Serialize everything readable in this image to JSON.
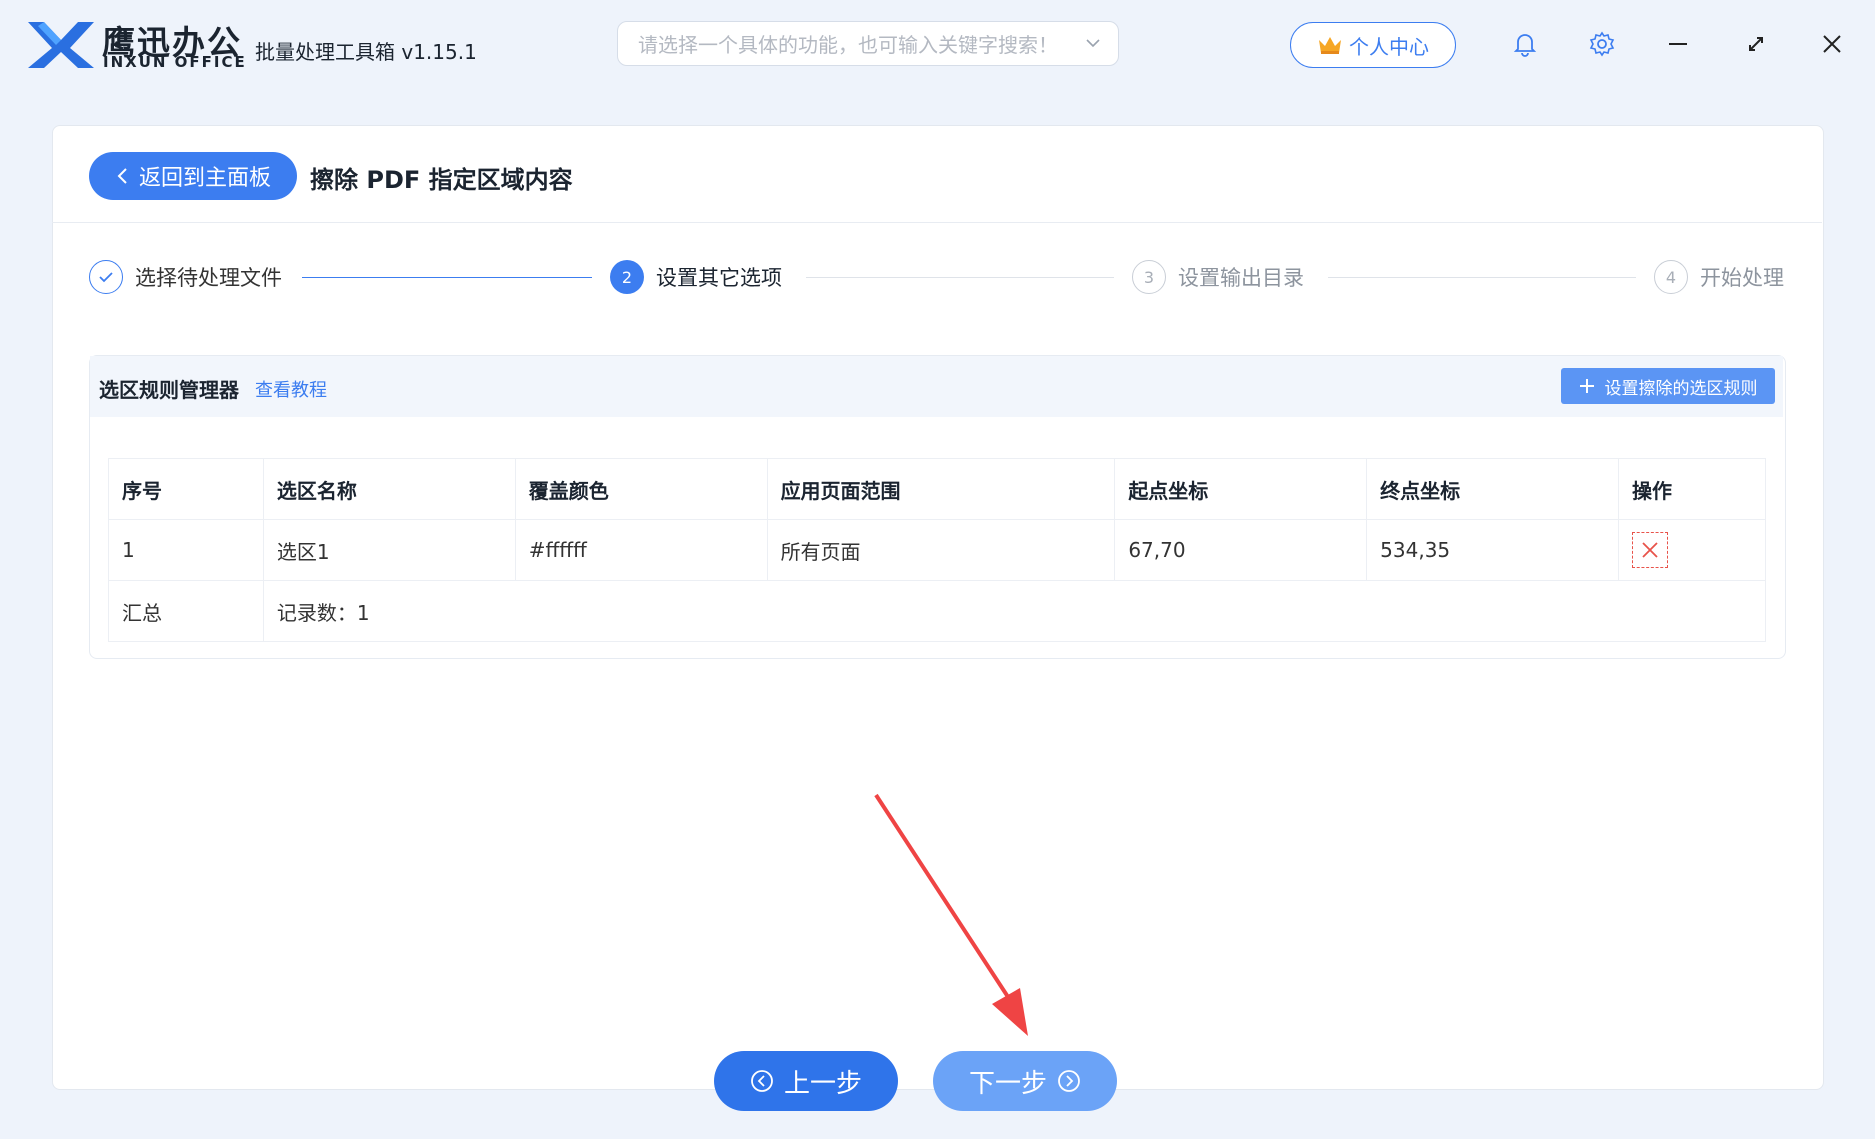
{
  "app": {
    "brand_cn": "鹰迅办公",
    "brand_en": "INXUN OFFICE",
    "title": "批量处理工具箱 v1.15.1"
  },
  "search": {
    "placeholder": "请选择一个具体的功能，也可输入关键字搜索！"
  },
  "header": {
    "user_center_label": "个人中心"
  },
  "page": {
    "back_label": "返回到主面板",
    "title": "擦除 PDF 指定区域内容"
  },
  "steps": [
    {
      "num": "",
      "label": "选择待处理文件",
      "state": "done"
    },
    {
      "num": "2",
      "label": "设置其它选项",
      "state": "active"
    },
    {
      "num": "3",
      "label": "设置输出目录",
      "state": "todo"
    },
    {
      "num": "4",
      "label": "开始处理",
      "state": "todo"
    }
  ],
  "rules": {
    "title": "选区规则管理器",
    "tutorial_link": "查看教程",
    "add_button": "设置擦除的选区规则",
    "columns": [
      "序号",
      "选区名称",
      "覆盖颜色",
      "应用页面范围",
      "起点坐标",
      "终点坐标",
      "操作"
    ],
    "rows": [
      {
        "index": "1",
        "name": "选区1",
        "color": "#ffffff",
        "range": "所有页面",
        "start": "67,70",
        "end": "534,35"
      }
    ],
    "summary_label": "汇总",
    "summary_value": "记录数：1"
  },
  "nav": {
    "prev_label": "上一步",
    "next_label": "下一步"
  },
  "colors": {
    "accent": "#3c7df0",
    "danger": "#e8534a",
    "annotation_arrow": "#ef4444"
  }
}
